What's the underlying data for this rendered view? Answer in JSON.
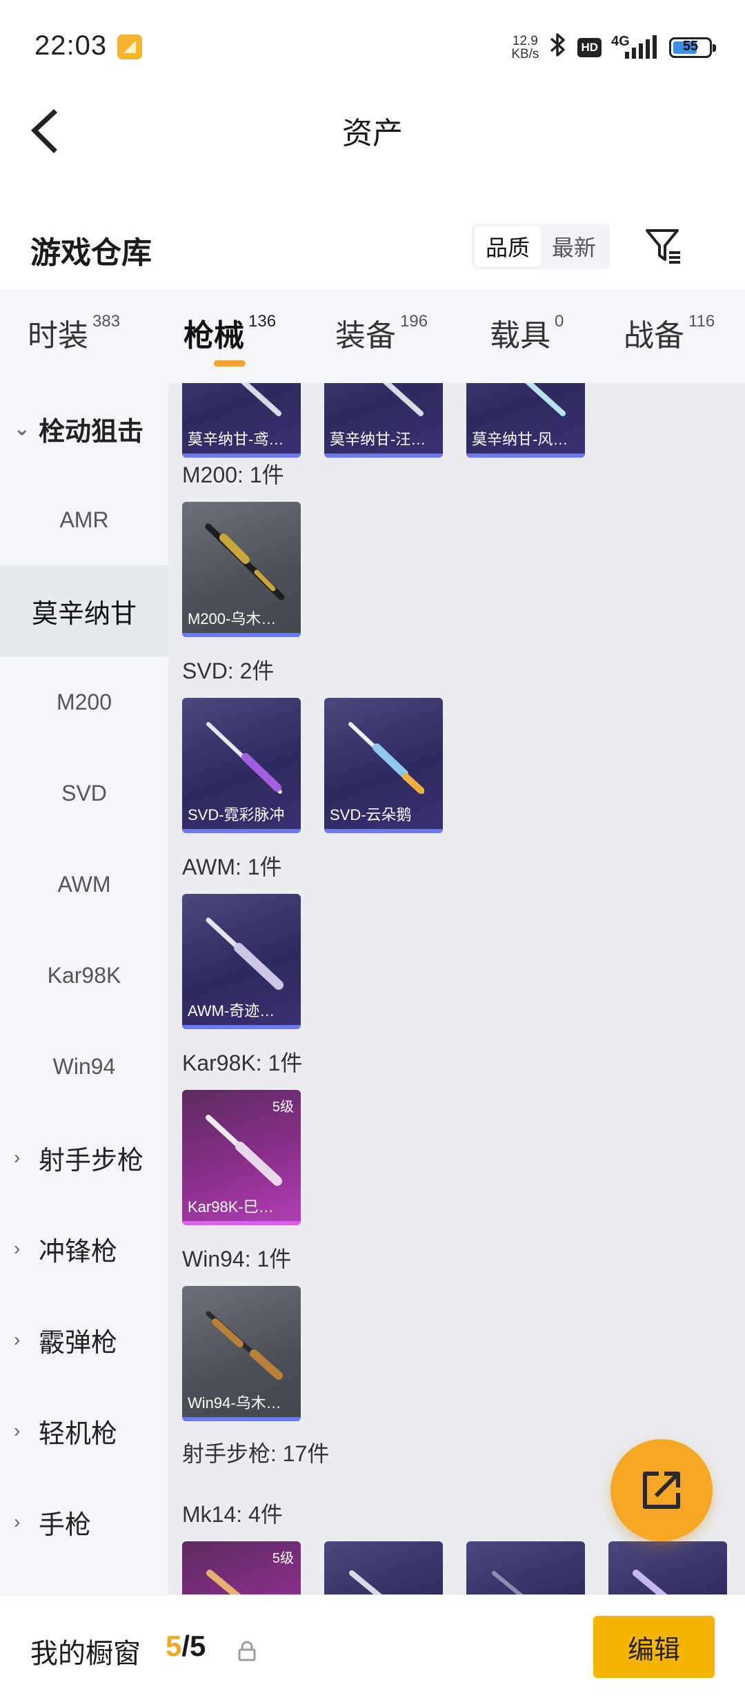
{
  "status_bar": {
    "time": "22:03",
    "net_speed_value": "12.9",
    "net_speed_unit": "KB/s",
    "hd_label": "HD",
    "network_label": "4G",
    "battery": "55"
  },
  "nav": {
    "title": "资产"
  },
  "warehouse": {
    "title": "游戏仓库",
    "sort_options": [
      "品质",
      "最新"
    ]
  },
  "tabs": [
    {
      "label": "时装",
      "count": "383"
    },
    {
      "label": "枪械",
      "count": "136"
    },
    {
      "label": "装备",
      "count": "196"
    },
    {
      "label": "载具",
      "count": "0"
    },
    {
      "label": "战备",
      "count": "116"
    }
  ],
  "sidebar": {
    "sniper_group": "栓动狙击",
    "sniper_items": [
      "AMR",
      "莫辛纳甘",
      "M200",
      "SVD",
      "AWM",
      "Kar98K",
      "Win94"
    ],
    "other_groups": [
      "射手步枪",
      "冲锋枪",
      "霰弹枪",
      "轻机枪",
      "手枪"
    ]
  },
  "content": {
    "top_row": [
      "莫辛纳甘-鸢…",
      "莫辛纳甘-汪…",
      "莫辛纳甘-风…"
    ],
    "m200": {
      "header": "M200: 1件",
      "items": [
        "M200-乌木…"
      ]
    },
    "svd": {
      "header": "SVD: 2件",
      "items": [
        "SVD-霓彩脉冲",
        "SVD-云朵鹅"
      ]
    },
    "awm": {
      "header": "AWM: 1件",
      "items": [
        "AWM-奇迹…"
      ]
    },
    "kar98k": {
      "header": "Kar98K: 1件",
      "items": [
        "Kar98K-巳…"
      ],
      "level": "5级"
    },
    "win94": {
      "header": "Win94: 1件",
      "items": [
        "Win94-乌木…"
      ]
    },
    "marksman_header": "射手步枪: 17件",
    "mk14": {
      "header": "Mk14: 4件",
      "level": "5级"
    }
  },
  "bottom_bar": {
    "label": "我的橱窗",
    "current": "5",
    "separator": "/",
    "max": "5",
    "edit_label": "编辑"
  },
  "colors": {
    "accent": "#f5a623",
    "edit_button": "#f7b500",
    "sidebar_bg": "#f4f6f9",
    "content_bg": "#ebedf1",
    "card_purple": "#3a3570",
    "card_gray": "#55575e",
    "card_pink": "#9b3ba0"
  }
}
